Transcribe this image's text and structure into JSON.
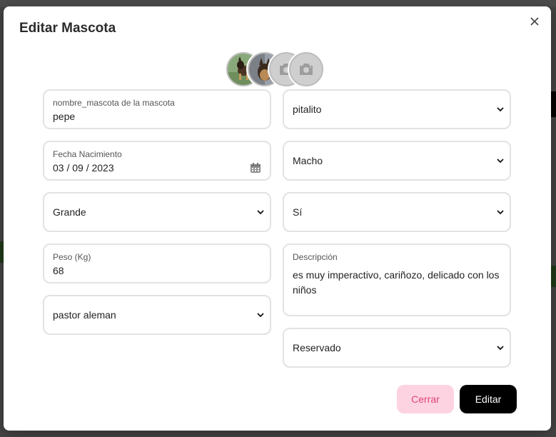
{
  "modal": {
    "title": "Editar Mascota",
    "close_icon": "close-icon"
  },
  "avatars": [
    {
      "kind": "photo",
      "icon": "dog-photo"
    },
    {
      "kind": "photo",
      "icon": "dog-photo"
    },
    {
      "kind": "placeholder",
      "icon": "camera-icon"
    },
    {
      "kind": "placeholder",
      "icon": "camera-icon"
    }
  ],
  "form": {
    "nombre": {
      "label": "nombre_mascota de la mascota",
      "value": "pepe"
    },
    "fecha": {
      "label": "Fecha Nacimiento",
      "value": "03 / 09 / 2023",
      "icon": "calendar-icon"
    },
    "tamano": {
      "value": "Grande"
    },
    "peso": {
      "label": "Peso (Kg)",
      "value": "68"
    },
    "raza": {
      "value": "pastor aleman"
    },
    "ubicacion": {
      "value": "pitalito"
    },
    "sexo": {
      "value": "Macho"
    },
    "esterilizado": {
      "value": "Sí"
    },
    "descripcion": {
      "label": "Descripción",
      "value": "es muy imperactivo, cariñozo, delicado con los niños"
    },
    "estado": {
      "value": "Reservado"
    }
  },
  "buttons": {
    "cerrar": "Cerrar",
    "editar": "Editar"
  },
  "colors": {
    "cerrar_bg": "#fdd3e1",
    "cerrar_text": "#e0457b",
    "editar_bg": "#000000",
    "border": "#e2e2e2"
  }
}
